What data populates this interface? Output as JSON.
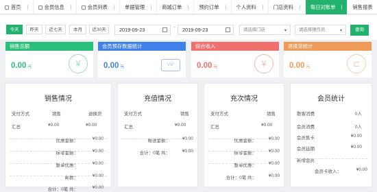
{
  "tabs": [
    {
      "label": "首页",
      "icon": "home-icon",
      "active": false
    },
    {
      "label": "会员信息",
      "icon": "document-icon",
      "active": false
    },
    {
      "label": "会员列表",
      "icon": "document-icon",
      "active": false
    },
    {
      "label": "单据管理",
      "icon": "",
      "active": false
    },
    {
      "label": "商城订单",
      "icon": "",
      "active": false
    },
    {
      "label": "预约订单",
      "icon": "",
      "active": false
    },
    {
      "label": "个人资料",
      "icon": "",
      "active": false
    },
    {
      "label": "门店资料",
      "icon": "",
      "active": false
    },
    {
      "label": "每日对账单",
      "icon": "",
      "active": true
    },
    {
      "label": "销售报表",
      "icon": "",
      "active": false
    }
  ],
  "filters": {
    "quick": [
      "今天",
      "昨天",
      "近七天",
      "本月",
      "近30天"
    ],
    "date_from": "2019-09-23",
    "date_to": "2019-09-23",
    "date_sep": "-",
    "store_placeholder": "请选择门店",
    "operator_placeholder": "请选择操作员",
    "query_label": "查询"
  },
  "cards": [
    {
      "title": "销售总额",
      "value": "0.00",
      "unit": "元",
      "color": "#2ac07a",
      "icon": "yen-circle-icon",
      "glyph": "¥"
    },
    {
      "title": "会员预存数据统计",
      "value": "0.00",
      "unit": "元",
      "color": "#3f80ea",
      "icon": "vip-card-icon",
      "glyph": "VIP"
    },
    {
      "title": "综合收入",
      "value": "0.00",
      "unit": "元",
      "color": "#f0706e",
      "icon": "receipt-icon",
      "glyph": "¥"
    },
    {
      "title": "退换货统计",
      "value": "0.00",
      "unit": "元",
      "color": "#f09a58",
      "icon": "wallet-icon",
      "glyph": "⊏"
    }
  ],
  "panels": {
    "sales": {
      "title": "销售情况",
      "headers": [
        "支付方式",
        "销售",
        "退换货"
      ],
      "summary": [
        "汇总",
        "¥0.00",
        "¥0.00"
      ],
      "lines": [
        {
          "label": "优惠金额：",
          "value": "¥0.00"
        },
        {
          "label": "抹零金额：",
          "value": "¥0.00"
        },
        {
          "label": "整单优惠：",
          "value": "¥0.00"
        },
        {
          "label": "邮费：",
          "value": "¥0.00"
        },
        {
          "label": "合计：0笔 共：",
          "value": "¥0.00"
        }
      ]
    },
    "recharge": {
      "title": "充值情况",
      "headers": [
        "支付方式",
        "销售"
      ],
      "summary": [
        "汇总",
        "¥0.00"
      ],
      "lines": [
        {
          "label": "赠送金额：",
          "value": "¥0.00"
        },
        {
          "label": "合计：0笔 共：",
          "value": "¥0.00"
        }
      ]
    },
    "times": {
      "title": "充次情况",
      "headers": [
        "支付方式",
        "销售"
      ],
      "summary": [
        "汇总",
        "¥0.00"
      ],
      "lines": [
        {
          "label": "优惠金额：",
          "value": "¥0.00"
        },
        {
          "label": "抹零金额：",
          "value": "¥0.00"
        },
        {
          "label": "整单优惠：",
          "value": "¥0.00"
        },
        {
          "label": "合计：0笔 共：",
          "value": "¥0.00"
        }
      ]
    },
    "members": {
      "title": "会员统计",
      "rows": [
        {
          "label": "散客消费",
          "value": "0人"
        },
        {
          "label": "会员消费",
          "value": "0人"
        },
        {
          "label": "会员售卡",
          "value": "¥0.00"
        },
        {
          "label": "会员延期",
          "value": "¥0.00"
        },
        {
          "label": "新增会员",
          "value": ""
        }
      ],
      "footer": {
        "label": "会员卡收入：",
        "value": "¥0.00"
      }
    }
  }
}
